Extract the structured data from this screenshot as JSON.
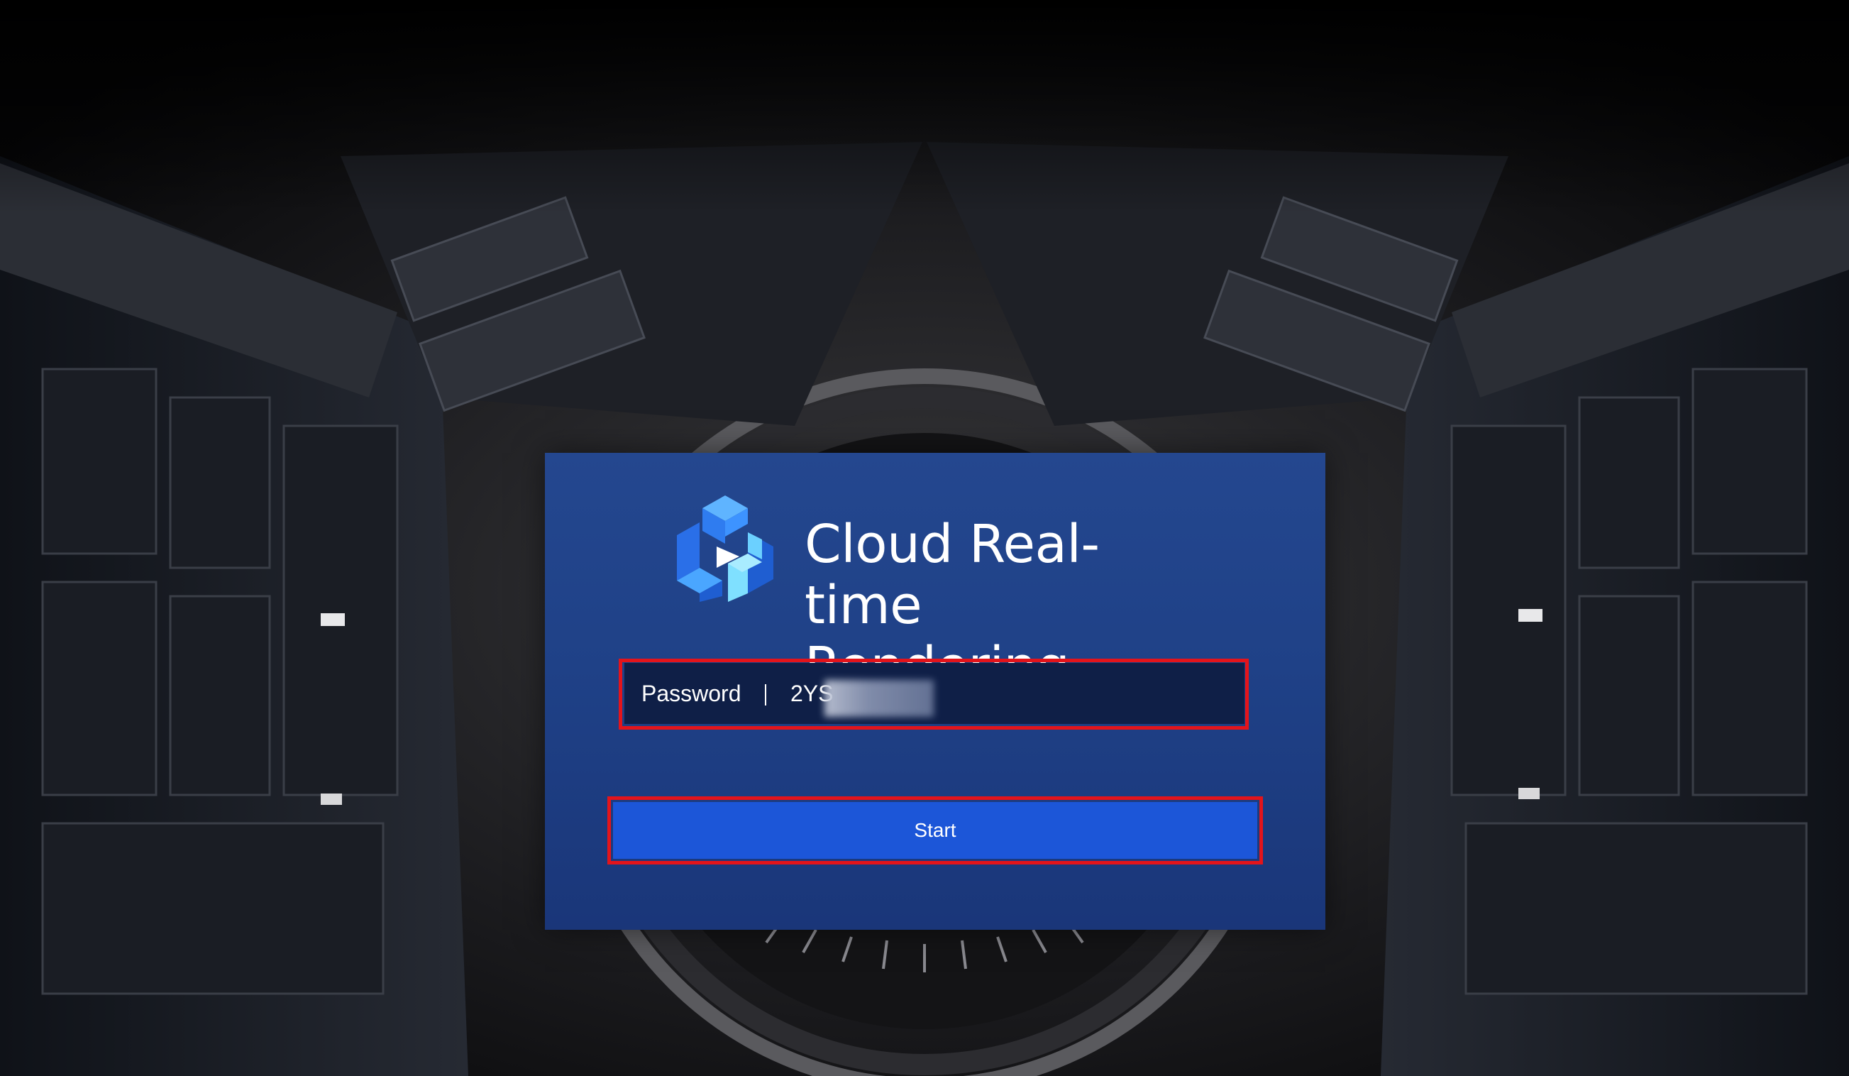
{
  "app": {
    "title": "Cloud Real-time\nRendering",
    "logo_icon": "cube-logo-icon"
  },
  "login": {
    "password_label": "Password",
    "password_value": "2YS",
    "password_value_obscured": true
  },
  "actions": {
    "start_label": "Start"
  },
  "colors": {
    "card_background": "#1f4187",
    "field_background": "#0f1f47",
    "button_background": "#1c56d8",
    "highlight_border": "#e3141b",
    "text": "#ffffff"
  }
}
